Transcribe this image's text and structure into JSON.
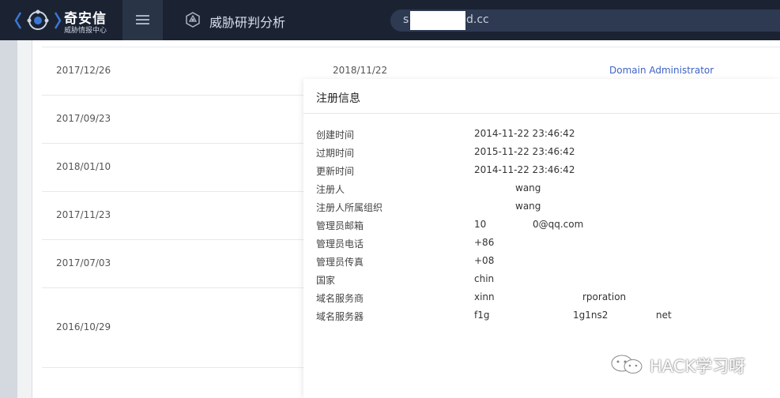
{
  "header": {
    "logo_title": "奇安信",
    "logo_subtitle": "威胁情报中心",
    "module_title": "威胁研判分析",
    "search_prefix": "s",
    "search_suffix": "d.cc"
  },
  "background_table": {
    "rows": [
      {
        "created": "2017/12/26",
        "updated": "2018/11/22",
        "role": "Domain Administrator"
      },
      {
        "created": "2017/09/23"
      },
      {
        "created": "2018/01/10"
      },
      {
        "created": "2017/11/23"
      },
      {
        "created": "2017/07/03"
      },
      {
        "created": "2016/10/29"
      }
    ]
  },
  "modal": {
    "title": "注册信息",
    "fields": [
      {
        "label": "创建时间",
        "value": "2014-11-22 23:46:42"
      },
      {
        "label": "过期时间",
        "value": "2015-11-22 23:46:42"
      },
      {
        "label": "更新时间",
        "value": "2014-11-22 23:46:42"
      },
      {
        "label": "注册人",
        "value": "wang"
      },
      {
        "label": "注册人所属组织",
        "value": "wang"
      },
      {
        "label": "管理员邮箱",
        "value": "10",
        "value_suffix": "0@qq.com"
      },
      {
        "label": "管理员电话",
        "value": "+86"
      },
      {
        "label": "管理员传真",
        "value": "+08"
      },
      {
        "label": "国家",
        "value": "chin"
      },
      {
        "label": "域名服务商",
        "value": "xinn",
        "value_suffix": "rporation"
      },
      {
        "label": "域名服务器",
        "value": "f1g",
        "value_suffix": "1g1ns2",
        "value_suffix2": "net"
      }
    ]
  },
  "watermark": {
    "text": "HACK学习呀",
    "icon": "wechat-icon"
  }
}
